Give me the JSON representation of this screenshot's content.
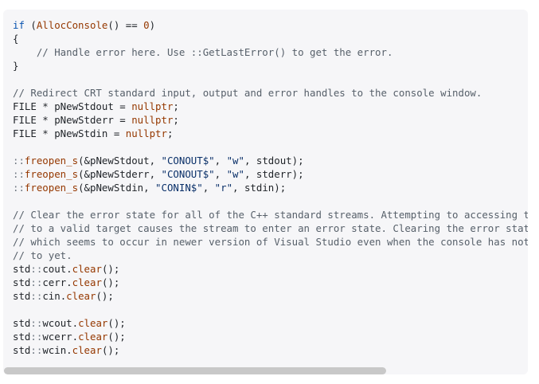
{
  "colors": {
    "background": "#f6f6f8",
    "keyword": "#0550ae",
    "function": "#953800",
    "number": "#953800",
    "string": "#0a3069",
    "comment": "#57606a",
    "namespace": "#6e7781",
    "plain": "#1f2328",
    "scroll_thumb": "#c8c8c8"
  },
  "scroll": {
    "thumb_fraction": 0.73
  },
  "code": {
    "language": "cpp",
    "lines": [
      [
        {
          "t": "kw",
          "v": "if"
        },
        {
          "t": "plain",
          "v": " ("
        },
        {
          "t": "fn",
          "v": "AllocConsole"
        },
        {
          "t": "plain",
          "v": "() == "
        },
        {
          "t": "num",
          "v": "0"
        },
        {
          "t": "plain",
          "v": ")"
        }
      ],
      [
        {
          "t": "plain",
          "v": "{"
        }
      ],
      [
        {
          "t": "cmt",
          "v": "    // Handle error here. Use ::GetLastError() to get the error."
        }
      ],
      [
        {
          "t": "plain",
          "v": "}"
        }
      ],
      [],
      [
        {
          "t": "cmt",
          "v": "// Redirect CRT standard input, output and error handles to the console window."
        }
      ],
      [
        {
          "t": "plain",
          "v": "FILE * pNewStdout = "
        },
        {
          "t": "num",
          "v": "nullptr"
        },
        {
          "t": "plain",
          "v": ";"
        }
      ],
      [
        {
          "t": "plain",
          "v": "FILE * pNewStderr = "
        },
        {
          "t": "num",
          "v": "nullptr"
        },
        {
          "t": "plain",
          "v": ";"
        }
      ],
      [
        {
          "t": "plain",
          "v": "FILE * pNewStdin = "
        },
        {
          "t": "num",
          "v": "nullptr"
        },
        {
          "t": "plain",
          "v": ";"
        }
      ],
      [],
      [
        {
          "t": "ns",
          "v": "::"
        },
        {
          "t": "fn",
          "v": "freopen_s"
        },
        {
          "t": "plain",
          "v": "(&pNewStdout, "
        },
        {
          "t": "str",
          "v": "\"CONOUT$\""
        },
        {
          "t": "plain",
          "v": ", "
        },
        {
          "t": "str",
          "v": "\"w\""
        },
        {
          "t": "plain",
          "v": ", stdout);"
        }
      ],
      [
        {
          "t": "ns",
          "v": "::"
        },
        {
          "t": "fn",
          "v": "freopen_s"
        },
        {
          "t": "plain",
          "v": "(&pNewStderr, "
        },
        {
          "t": "str",
          "v": "\"CONOUT$\""
        },
        {
          "t": "plain",
          "v": ", "
        },
        {
          "t": "str",
          "v": "\"w\""
        },
        {
          "t": "plain",
          "v": ", stderr);"
        }
      ],
      [
        {
          "t": "ns",
          "v": "::"
        },
        {
          "t": "fn",
          "v": "freopen_s"
        },
        {
          "t": "plain",
          "v": "(&pNewStdin, "
        },
        {
          "t": "str",
          "v": "\"CONIN$\""
        },
        {
          "t": "plain",
          "v": ", "
        },
        {
          "t": "str",
          "v": "\"r\""
        },
        {
          "t": "plain",
          "v": ", stdin);"
        }
      ],
      [],
      [
        {
          "t": "cmt",
          "v": "// Clear the error state for all of the C++ standard streams. Attempting to accessing the streams before they refer"
        }
      ],
      [
        {
          "t": "cmt",
          "v": "// to a valid target causes the stream to enter an error state. Clearing the error state will fix this problem,"
        }
      ],
      [
        {
          "t": "cmt",
          "v": "// which seems to occur in newer version of Visual Studio even when the console has not been read from or written"
        }
      ],
      [
        {
          "t": "cmt",
          "v": "// to yet."
        }
      ],
      [
        {
          "t": "plain",
          "v": "std"
        },
        {
          "t": "ns",
          "v": "::"
        },
        {
          "t": "plain",
          "v": "cout."
        },
        {
          "t": "fn",
          "v": "clear"
        },
        {
          "t": "plain",
          "v": "();"
        }
      ],
      [
        {
          "t": "plain",
          "v": "std"
        },
        {
          "t": "ns",
          "v": "::"
        },
        {
          "t": "plain",
          "v": "cerr."
        },
        {
          "t": "fn",
          "v": "clear"
        },
        {
          "t": "plain",
          "v": "();"
        }
      ],
      [
        {
          "t": "plain",
          "v": "std"
        },
        {
          "t": "ns",
          "v": "::"
        },
        {
          "t": "plain",
          "v": "cin."
        },
        {
          "t": "fn",
          "v": "clear"
        },
        {
          "t": "plain",
          "v": "();"
        }
      ],
      [],
      [
        {
          "t": "plain",
          "v": "std"
        },
        {
          "t": "ns",
          "v": "::"
        },
        {
          "t": "plain",
          "v": "wcout."
        },
        {
          "t": "fn",
          "v": "clear"
        },
        {
          "t": "plain",
          "v": "();"
        }
      ],
      [
        {
          "t": "plain",
          "v": "std"
        },
        {
          "t": "ns",
          "v": "::"
        },
        {
          "t": "plain",
          "v": "wcerr."
        },
        {
          "t": "fn",
          "v": "clear"
        },
        {
          "t": "plain",
          "v": "();"
        }
      ],
      [
        {
          "t": "plain",
          "v": "std"
        },
        {
          "t": "ns",
          "v": "::"
        },
        {
          "t": "plain",
          "v": "wcin."
        },
        {
          "t": "fn",
          "v": "clear"
        },
        {
          "t": "plain",
          "v": "();"
        }
      ]
    ]
  }
}
